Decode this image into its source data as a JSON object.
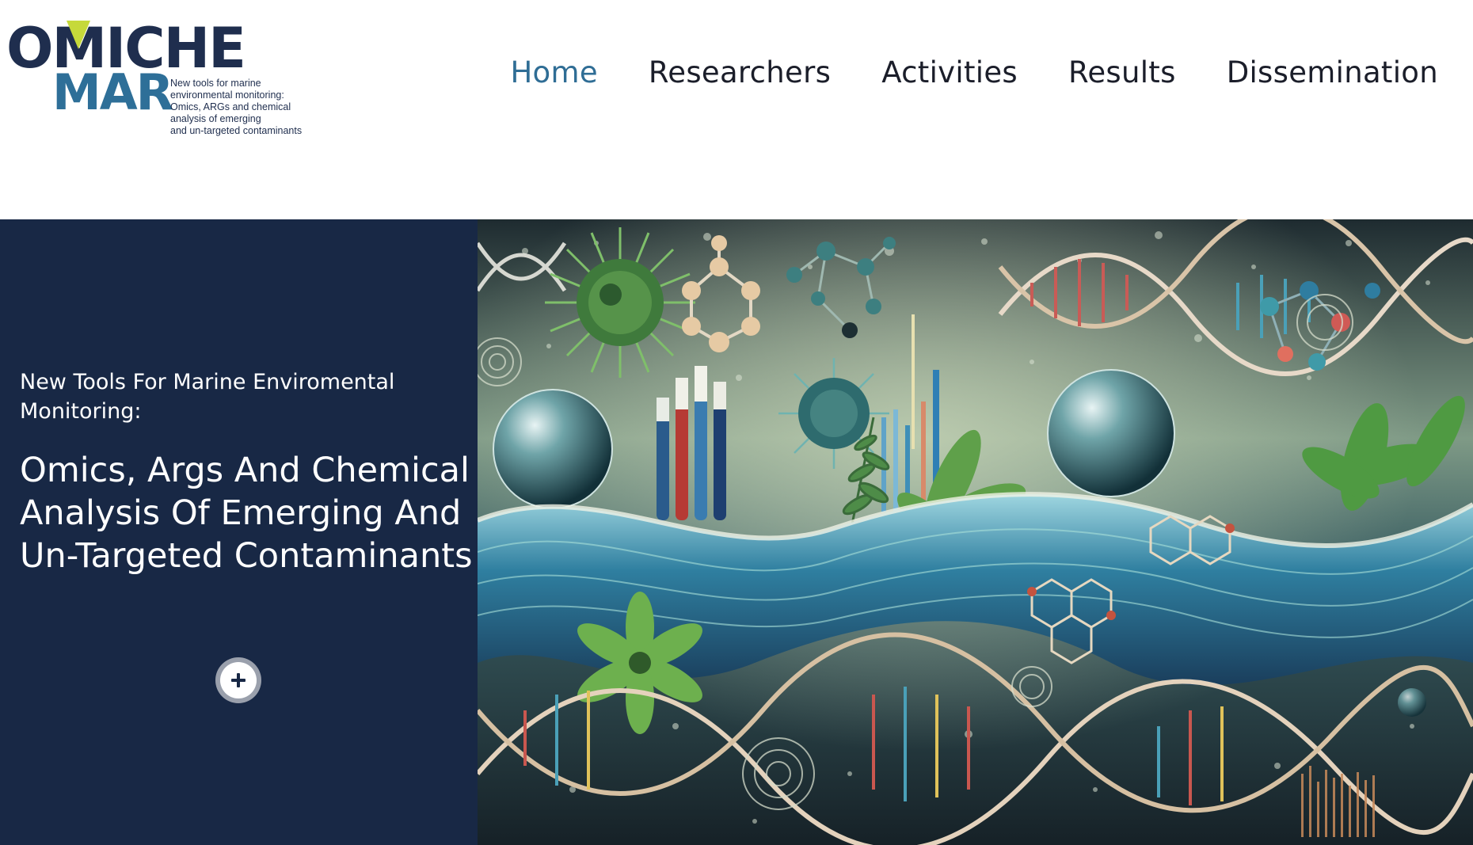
{
  "logo": {
    "line1": "OMICHE",
    "line2": "MAR",
    "tagline": [
      "New tools for marine",
      "environmental monitoring:",
      "Omics, ARGs and chemical",
      "analysis of emerging",
      "and un-targeted contaminants"
    ],
    "colors": {
      "dark": "#1f2e4e",
      "blue": "#2e6f98",
      "accent": "#c6d93a"
    }
  },
  "nav": {
    "items": [
      {
        "label": "Home",
        "active": true
      },
      {
        "label": "Researchers",
        "active": false
      },
      {
        "label": "Activities",
        "active": false
      },
      {
        "label": "Results",
        "active": false
      },
      {
        "label": "Dissemination",
        "active": false
      }
    ],
    "active_color": "#2f6d95"
  },
  "hero": {
    "subtitle": "New Tools For Marine Enviromental Monitoring:",
    "title": "Omics, Args And Chemical Analysis Of Emerging And Un-Targeted Contaminants",
    "more_button_icon": "plus-icon",
    "panel_color": "#182845"
  }
}
